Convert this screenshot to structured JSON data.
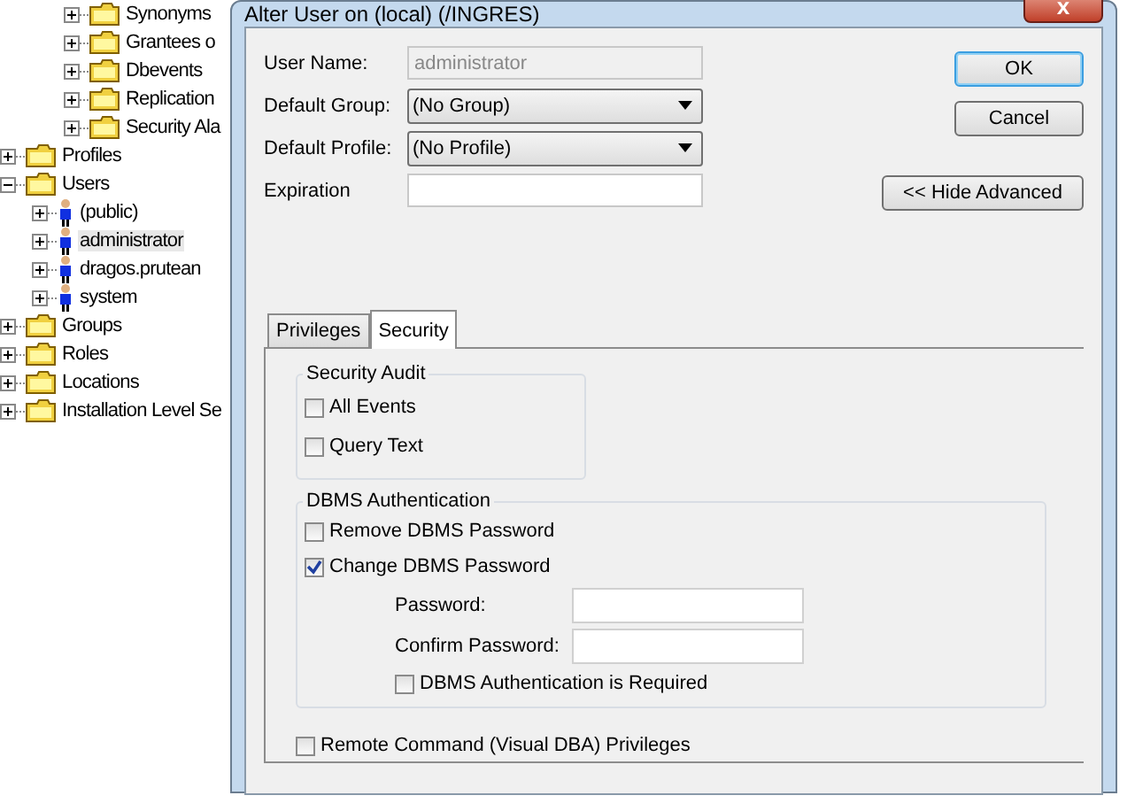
{
  "tree": {
    "continued_children": [
      {
        "label": "Synonyms",
        "kind": "folder",
        "expanded": false,
        "selected": false
      },
      {
        "label": "Grantees o",
        "kind": "folder",
        "expanded": false,
        "selected": false
      },
      {
        "label": "Dbevents",
        "kind": "folder",
        "expanded": false,
        "selected": false
      },
      {
        "label": "Replication",
        "kind": "folder",
        "expanded": false,
        "selected": false
      },
      {
        "label": "Security Ala",
        "kind": "folder",
        "expanded": false,
        "selected": false
      }
    ],
    "items": [
      {
        "label": "Profiles",
        "kind": "folder",
        "expanded": false,
        "selected": false
      },
      {
        "label": "Users",
        "kind": "folder",
        "expanded": true,
        "selected": false,
        "children": [
          {
            "label": "(public)",
            "kind": "user",
            "expanded": false,
            "selected": false
          },
          {
            "label": "administrator",
            "kind": "user",
            "expanded": false,
            "selected": true
          },
          {
            "label": "dragos.prutean",
            "kind": "user",
            "expanded": false,
            "selected": false
          },
          {
            "label": "system",
            "kind": "user",
            "expanded": false,
            "selected": false
          }
        ]
      },
      {
        "label": "Groups",
        "kind": "folder",
        "expanded": false,
        "selected": false
      },
      {
        "label": "Roles",
        "kind": "folder",
        "expanded": false,
        "selected": false
      },
      {
        "label": "Locations",
        "kind": "folder",
        "expanded": false,
        "selected": false
      },
      {
        "label": "Installation Level Se",
        "kind": "folder",
        "expanded": false,
        "selected": false
      }
    ]
  },
  "dialog": {
    "title": "Alter User on (local) (/INGRES)",
    "close": "x",
    "fields": [
      {
        "label": "User Name:",
        "kind": "text",
        "value": "administrator",
        "disabled": true
      },
      {
        "label": "Default Group:",
        "kind": "dropdown",
        "value": "(No Group)",
        "disabled": false
      },
      {
        "label": "Default Profile:",
        "kind": "dropdown",
        "value": "(No Profile)",
        "disabled": false
      },
      {
        "label": "Expiration",
        "kind": "text",
        "disabled": false
      }
    ],
    "buttons": [
      {
        "label": "OK",
        "default": true
      },
      {
        "label": "Cancel",
        "default": false
      }
    ],
    "advanced_button": "<< Hide Advanced",
    "tabs": [
      {
        "label": "Privileges",
        "selected": false
      },
      {
        "label": "Security",
        "selected": true
      }
    ],
    "security_audit": {
      "title": "Security Audit",
      "options": [
        {
          "label": "All Events",
          "checked": false
        },
        {
          "label": "Query Text",
          "checked": false
        }
      ]
    },
    "dbms_authentication": {
      "title": "DBMS Authentication",
      "remove_password": {
        "label": "Remove DBMS Password",
        "checked": false
      },
      "change_password": {
        "label": "Change DBMS Password",
        "checked": true
      },
      "password_fields": [
        {
          "label": "Password:"
        },
        {
          "label": "Confirm Password:"
        }
      ],
      "required": {
        "label": "DBMS Authentication is Required",
        "checked": false
      }
    },
    "remote_command": {
      "label": "Remote Command (Visual DBA) Privileges",
      "checked": false
    }
  }
}
